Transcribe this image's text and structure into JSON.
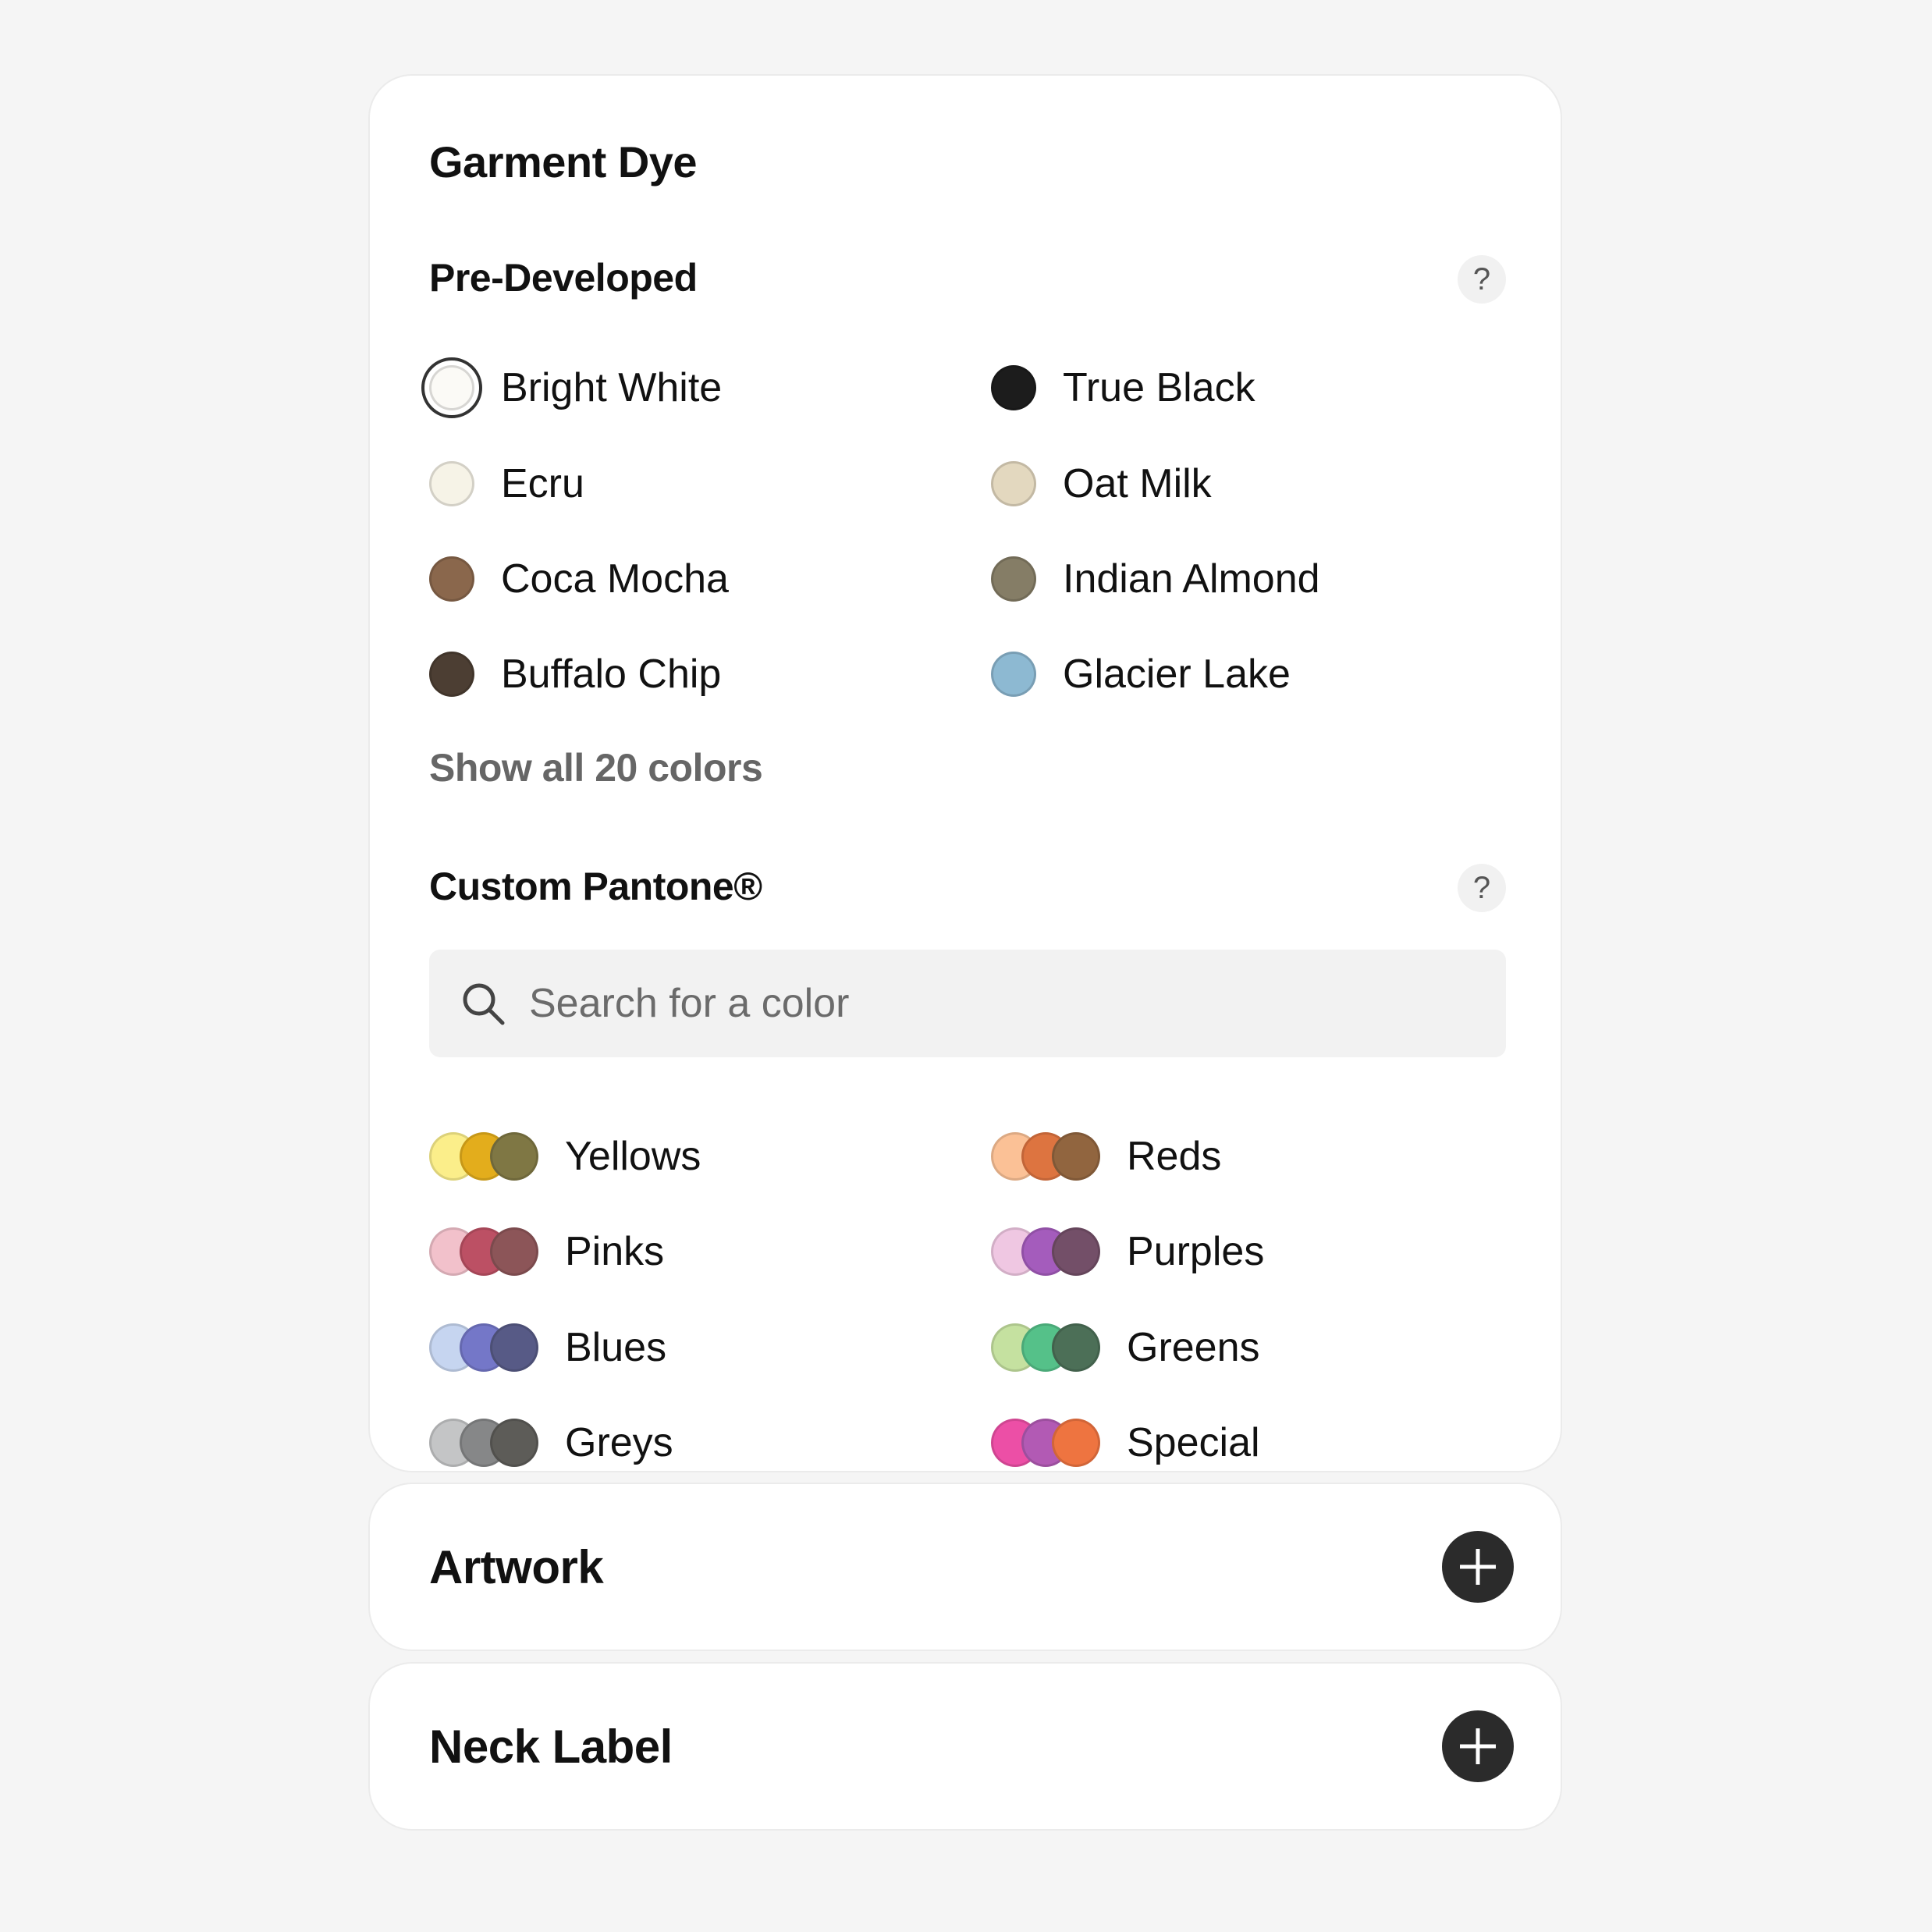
{
  "garment_dye": {
    "title": "Garment Dye",
    "pre_developed": {
      "heading": "Pre-Developed",
      "help": "?",
      "selected": "Bright White",
      "colors": [
        {
          "label": "Bright White",
          "color": "#fbfaf6"
        },
        {
          "label": "True Black",
          "color": "#1c1c1c"
        },
        {
          "label": "Ecru",
          "color": "#f6f3e7"
        },
        {
          "label": "Oat Milk",
          "color": "#e3d8bf"
        },
        {
          "label": "Coca Mocha",
          "color": "#8a674c"
        },
        {
          "label": "Indian Almond",
          "color": "#857d66"
        },
        {
          "label": "Buffalo Chip",
          "color": "#4c3e33"
        },
        {
          "label": "Glacier Lake",
          "color": "#8db9d2"
        }
      ],
      "show_all": "Show all 20 colors"
    },
    "custom_pantone": {
      "heading": "Custom Pantone®",
      "help": "?",
      "search_placeholder": "Search for a color",
      "families": [
        {
          "label": "Yellows",
          "colors": [
            "#fbee8a",
            "#e3ad1c",
            "#7f7744"
          ]
        },
        {
          "label": "Reds",
          "colors": [
            "#fbc196",
            "#dd7440",
            "#91653f"
          ]
        },
        {
          "label": "Pinks",
          "colors": [
            "#f2c1cb",
            "#bc5064",
            "#8c5558"
          ]
        },
        {
          "label": "Purples",
          "colors": [
            "#efc7e2",
            "#a45cbc",
            "#734f68"
          ]
        },
        {
          "label": "Blues",
          "colors": [
            "#c6d5f0",
            "#7477c8",
            "#575a86"
          ]
        },
        {
          "label": "Greens",
          "colors": [
            "#c5e1a0",
            "#55c189",
            "#4c6f57"
          ]
        },
        {
          "label": "Greys",
          "colors": [
            "#c4c5c6",
            "#868788",
            "#5d5c58"
          ]
        },
        {
          "label": "Special",
          "colors": [
            "#ec4fa6",
            "#b25ab4",
            "#ee7440"
          ]
        }
      ]
    }
  },
  "artwork": {
    "title": "Artwork"
  },
  "neck_label": {
    "title": "Neck Label"
  }
}
